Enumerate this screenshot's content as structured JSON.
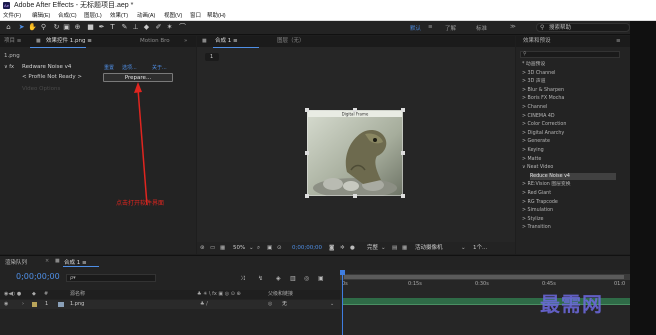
{
  "window": {
    "title": "Adobe After Effects - 无标题项目.aep *",
    "logo_text": "Ae"
  },
  "menu": [
    "文件(F)",
    "编辑(E)",
    "合成(C)",
    "图层(L)",
    "效果(T)",
    "动画(A)",
    "视图(V)",
    "窗口",
    "帮助(H)"
  ],
  "toolbar": {
    "workspaces": [
      "默认",
      "≡",
      "了解",
      "标准",
      "≫"
    ],
    "search_placeholder": "搜索帮助"
  },
  "project_panel": {
    "tabs": [
      "项目 ≡",
      "效果控件 1.png ≡",
      "Motion Bro"
    ],
    "layer_label": "1.png",
    "effect_name": "Redware Noise v4",
    "effect_links": [
      "重置",
      "选项...",
      "关于..."
    ],
    "profile_label": "< Profile Not Ready >",
    "button_label": "Prepare...",
    "disabled_row": "Video Options",
    "annotation": "点击打开软件界面"
  },
  "comp_panel": {
    "tabs": [
      "合成 1 ≡",
      "图层（无）"
    ],
    "breadcrumb": "1",
    "image_caption": "Digital Frame",
    "bottom_bar": {
      "zoom": "50%",
      "timecode": "0;00;00;00",
      "quality": "完整",
      "camera": "活动摄像机",
      "views": "1个..."
    }
  },
  "effects_panel": {
    "title": "效果和预设",
    "items": [
      {
        "label": "* 动画预设",
        "level": 0
      },
      {
        "label": "> 3D Channel",
        "level": 0
      },
      {
        "label": "> 3D 声道",
        "level": 0
      },
      {
        "label": "> Blur & Sharpen",
        "level": 0
      },
      {
        "label": "> Boris FX Mocha",
        "level": 0
      },
      {
        "label": "> Channel",
        "level": 0
      },
      {
        "label": "> CINEMA 4D",
        "level": 0
      },
      {
        "label": "> Color Correction",
        "level": 0
      },
      {
        "label": "> Digital Anarchy",
        "level": 0
      },
      {
        "label": "> Generate",
        "level": 0
      },
      {
        "label": "> Keying",
        "level": 0
      },
      {
        "label": "> Matte",
        "level": 0
      },
      {
        "label": "∨ Neat Video",
        "level": 0
      },
      {
        "label": "Reduce Noise v4",
        "level": 1,
        "selected": true
      },
      {
        "label": "> RE:Vision 图层变换",
        "level": 0
      },
      {
        "label": "> Red Giant",
        "level": 0
      },
      {
        "label": "> RG Trapcode",
        "level": 0
      },
      {
        "label": "> Simulation",
        "level": 0
      },
      {
        "label": "> Stylize",
        "level": 0
      },
      {
        "label": "> Transition",
        "level": 0
      }
    ]
  },
  "timeline": {
    "tab_label": "渲染队列",
    "comp_tab": "合成 1 ≡",
    "timecode": "0;00;00;00",
    "search_placeholder": "ρ▾",
    "col_source": "源名称",
    "col_parent": "父级和链接",
    "layer_index": "1",
    "layer_name": "1.png",
    "parent_value": "无",
    "ruler_labels": [
      "0s",
      "0:15s",
      "0:30s",
      "0:45s",
      "01:0"
    ]
  },
  "watermark": "最需网",
  "colors": {
    "accent_blue": "#4f8fe6",
    "annotation_red": "#e0251f",
    "time_marker": "#3f7de0"
  }
}
